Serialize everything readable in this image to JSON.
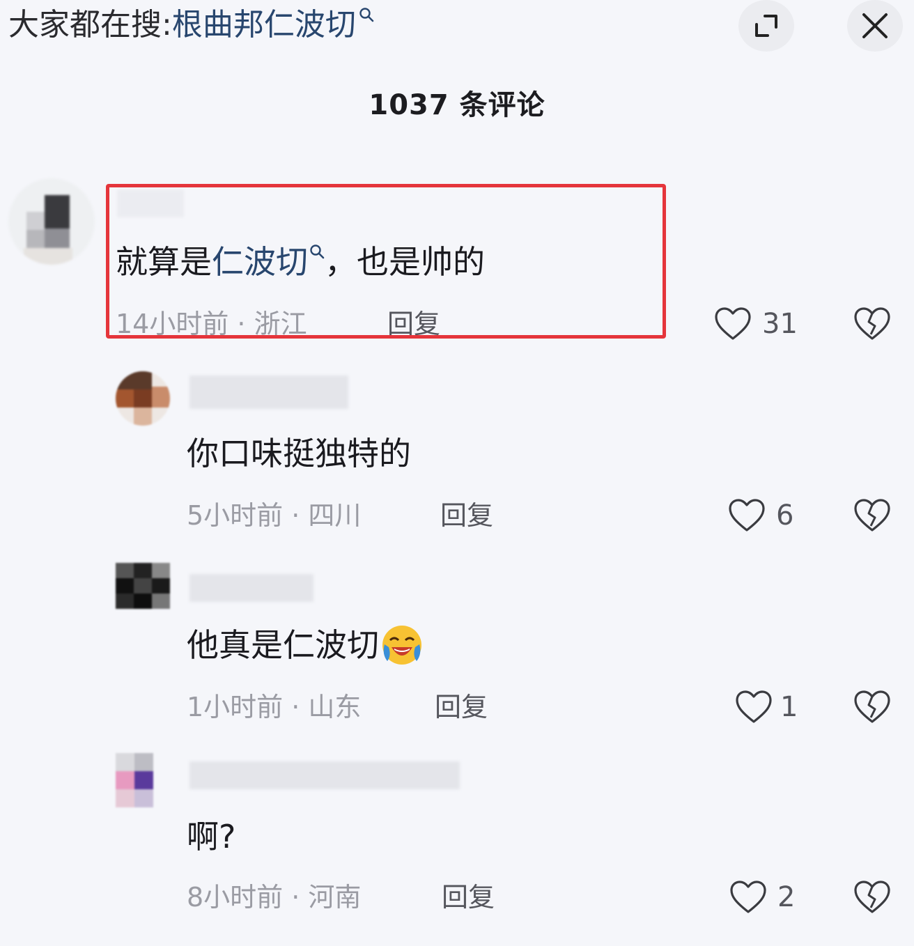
{
  "header": {
    "search_prefix": "大家都在搜:",
    "search_keyword": "根曲邦仁波切",
    "expand_icon": "expand-icon",
    "close_icon": "close-icon"
  },
  "comment_count_title": "1037 条评论",
  "comments": [
    {
      "username": "",
      "text_before": "就算是",
      "keyword": "仁波切",
      "text_after": "，也是帅的",
      "meta": "14小时前 · 浙江",
      "reply_label": "回复",
      "likes": "31"
    },
    {
      "username": "",
      "text": "你口味挺独特的",
      "meta": "5小时前 · 四川",
      "reply_label": "回复",
      "likes": "6"
    },
    {
      "username": "",
      "text": "他真是仁波切",
      "emoji": "laughing-crying-emoji",
      "meta": "1小时前 · 山东",
      "reply_label": "回复",
      "likes": "1"
    },
    {
      "username": "",
      "text": "啊?",
      "meta": "8小时前 · 河南",
      "reply_label": "回复",
      "likes": "2"
    }
  ],
  "colors": {
    "highlight_border": "#e5353b",
    "keyword": "#28466e",
    "background": "#f5f6fa"
  }
}
